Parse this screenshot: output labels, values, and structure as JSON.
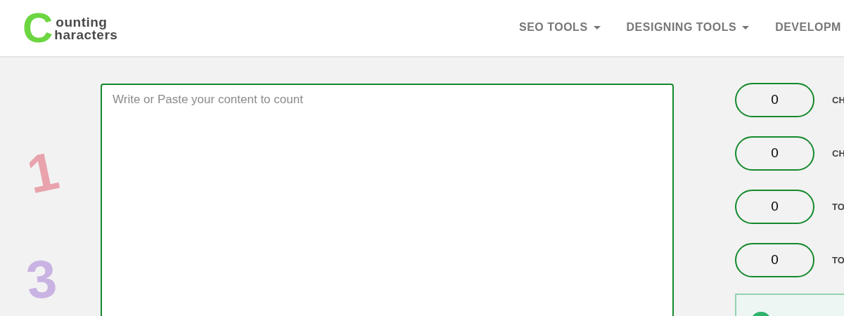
{
  "logo": {
    "initial": "C",
    "line1": "ounting",
    "line2": "haracters"
  },
  "nav": [
    {
      "label": "SEO TOOLS",
      "dropdown": true
    },
    {
      "label": "DESIGNING TOOLS",
      "dropdown": true
    },
    {
      "label": "DEVELOPM",
      "dropdown": false
    }
  ],
  "decorations": [
    {
      "digit": "1",
      "color": "#e8a3ad"
    },
    {
      "digit": "3",
      "color": "#c9b3e3"
    }
  ],
  "editor": {
    "placeholder": "Write or Paste your content to count"
  },
  "stats": [
    {
      "value": "0",
      "label": "CH"
    },
    {
      "value": "0",
      "label": "CH"
    },
    {
      "value": "0",
      "label": "TO"
    },
    {
      "value": "0",
      "label": "TO"
    }
  ]
}
